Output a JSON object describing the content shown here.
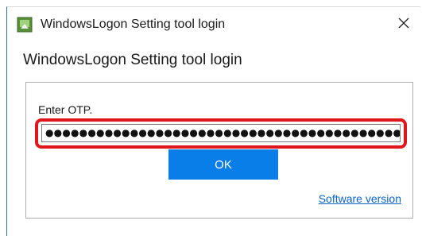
{
  "window": {
    "title": "WindowsLogon Setting tool login",
    "close_glyph": "✕",
    "app_icon": "app-icon"
  },
  "heading": "WindowsLogon Setting tool login",
  "form": {
    "otp_label": "Enter OTP.",
    "otp_value": "●●●●●●●●●●●●●●●●●●●●●●●●●●●●●●●●●●●●●●●●●●●",
    "ok_label": "OK",
    "version_link": "Software version"
  },
  "colors": {
    "accent": "#0a7ee8",
    "highlight": "#e0161b",
    "link": "#0b63c5"
  }
}
